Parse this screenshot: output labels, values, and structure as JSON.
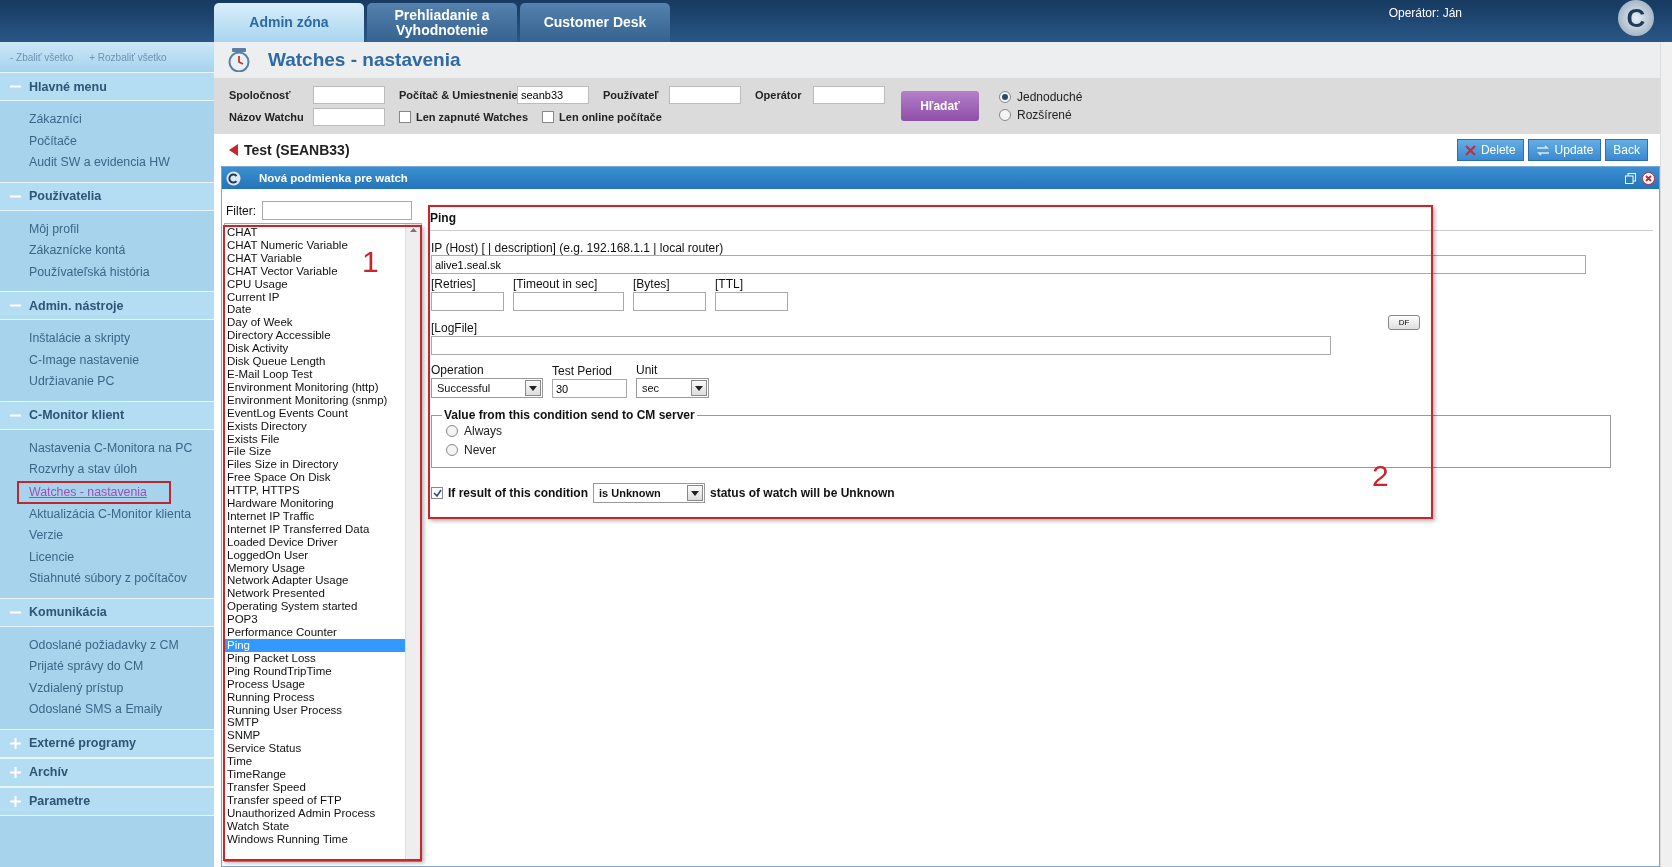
{
  "header": {
    "tabs": [
      {
        "label": "Admin zóna",
        "selected": true
      },
      {
        "label": "Prehliadanie a Vyhodnotenie",
        "selected": false
      },
      {
        "label": "Customer Desk",
        "selected": false
      }
    ],
    "operator": "Operátor: Ján",
    "logo": "C"
  },
  "sidebar": {
    "collapse_all": "- Zbaliť všetko",
    "expand_all": "+ Rozbaliť všetko",
    "sections": [
      {
        "title": "Hlavné menu",
        "expanded": true,
        "items": [
          {
            "label": "Zákazníci",
            "selected": false
          },
          {
            "label": "Počítače",
            "selected": false
          },
          {
            "label": "Audit SW a evidencia HW",
            "selected": false
          }
        ]
      },
      {
        "title": "Používatelia",
        "expanded": true,
        "items": [
          {
            "label": "Môj profil",
            "selected": false
          },
          {
            "label": "Zákaznícke kontá",
            "selected": false
          },
          {
            "label": "Používateľská história",
            "selected": false
          }
        ]
      },
      {
        "title": "Admin. nástroje",
        "expanded": true,
        "items": [
          {
            "label": "Inštalácie a skripty",
            "selected": false
          },
          {
            "label": "C-Image nastavenie",
            "selected": false
          },
          {
            "label": "Udržiavanie PC",
            "selected": false
          }
        ]
      },
      {
        "title": "C-Monitor klient",
        "expanded": true,
        "items": [
          {
            "label": "Nastavenia C-Monitora na PC",
            "selected": false
          },
          {
            "label": "Rozvrhy a stav úloh",
            "selected": false
          },
          {
            "label": "Watches - nastavenia",
            "selected": true
          },
          {
            "label": "Aktualizácia C-Monitor klienta",
            "selected": false
          },
          {
            "label": "Verzie",
            "selected": false
          },
          {
            "label": "Licencie",
            "selected": false
          },
          {
            "label": "Stiahnuté súbory z počítačov",
            "selected": false
          }
        ]
      },
      {
        "title": "Komunikácia",
        "expanded": true,
        "items": [
          {
            "label": "Odoslané požiadavky z CM",
            "selected": false
          },
          {
            "label": "Prijaté správy do CM",
            "selected": false
          },
          {
            "label": "Vzdialený prístup",
            "selected": false
          },
          {
            "label": "Odoslané SMS a Emaily",
            "selected": false
          }
        ]
      },
      {
        "title": "Externé programy",
        "expanded": false
      },
      {
        "title": "Archív",
        "expanded": false
      },
      {
        "title": "Parametre",
        "expanded": false
      }
    ]
  },
  "page_title": "Watches - nastavenia",
  "filter": {
    "fields": [
      {
        "label": "Spoločnosť"
      },
      {
        "label": "Počítač & Umiestnenie",
        "value": "seanb33"
      },
      {
        "label": "Používateľ"
      },
      {
        "label": "Operátor"
      },
      {
        "label": "Názov Watchu"
      }
    ],
    "checkboxes": [
      {
        "label": "Len zapnuté Watches",
        "checked": false
      },
      {
        "label": "Len online počítače",
        "checked": false
      }
    ],
    "search_button": "Hľadať",
    "modes": [
      {
        "label": "Jednoduché",
        "selected": true
      },
      {
        "label": "Rozšírené",
        "selected": false
      }
    ]
  },
  "record": {
    "title": "Test (SEANB33)",
    "buttons": [
      "Delete",
      "Update",
      "Back"
    ]
  },
  "dialog": {
    "title": "Nová podmienka pre watch",
    "filter_label": "Filter:",
    "types": [
      {
        "label": "CHAT",
        "selected": false
      },
      {
        "label": "CHAT Numeric Variable",
        "selected": false
      },
      {
        "label": "CHAT Variable",
        "selected": false
      },
      {
        "label": "CHAT Vector Variable",
        "selected": false
      },
      {
        "label": "CPU Usage",
        "selected": false
      },
      {
        "label": "Current IP",
        "selected": false
      },
      {
        "label": "Date",
        "selected": false
      },
      {
        "label": "Day of Week",
        "selected": false
      },
      {
        "label": "Directory Accessible",
        "selected": false
      },
      {
        "label": "Disk Activity",
        "selected": false
      },
      {
        "label": "Disk Queue Length",
        "selected": false
      },
      {
        "label": "E-Mail Loop Test",
        "selected": false
      },
      {
        "label": "Environment Monitoring (http)",
        "selected": false
      },
      {
        "label": "Environment Monitoring (snmp)",
        "selected": false
      },
      {
        "label": "EventLog Events Count",
        "selected": false
      },
      {
        "label": "Exists Directory",
        "selected": false
      },
      {
        "label": "Exists File",
        "selected": false
      },
      {
        "label": "File Size",
        "selected": false
      },
      {
        "label": "Files Size in Directory",
        "selected": false
      },
      {
        "label": "Free Space On Disk",
        "selected": false
      },
      {
        "label": "HTTP, HTTPS",
        "selected": false
      },
      {
        "label": "Hardware Monitoring",
        "selected": false
      },
      {
        "label": "Internet IP Traffic",
        "selected": false
      },
      {
        "label": "Internet IP Transferred Data",
        "selected": false
      },
      {
        "label": "Loaded Device Driver",
        "selected": false
      },
      {
        "label": "LoggedOn User",
        "selected": false
      },
      {
        "label": "Memory Usage",
        "selected": false
      },
      {
        "label": "Network Adapter Usage",
        "selected": false
      },
      {
        "label": "Network Presented",
        "selected": false
      },
      {
        "label": "Operating System started",
        "selected": false
      },
      {
        "label": "POP3",
        "selected": false
      },
      {
        "label": "Performance Counter",
        "selected": false
      },
      {
        "label": "Ping",
        "selected": true
      },
      {
        "label": "Ping Packet Loss",
        "selected": false
      },
      {
        "label": "Ping RoundTripTime",
        "selected": false
      },
      {
        "label": "Process Usage",
        "selected": false
      },
      {
        "label": "Running Process",
        "selected": false
      },
      {
        "label": "Running User Process",
        "selected": false
      },
      {
        "label": "SMTP",
        "selected": false
      },
      {
        "label": "SNMP",
        "selected": false
      },
      {
        "label": "Service Status",
        "selected": false
      },
      {
        "label": "Time",
        "selected": false
      },
      {
        "label": "TimeRange",
        "selected": false
      },
      {
        "label": "Transfer Speed",
        "selected": false
      },
      {
        "label": "Transfer speed of FTP",
        "selected": false
      },
      {
        "label": "Unauthorized Admin Process",
        "selected": false
      },
      {
        "label": "Watch State",
        "selected": false
      },
      {
        "label": "Windows Running Time",
        "selected": false
      }
    ],
    "form": {
      "title": "Ping",
      "host_label": "IP (Host) [ | description] (e.g. 192.168.1.1 | local router)",
      "host_value": "alive1.seal.sk",
      "small_fields": [
        {
          "label": "[Retries]"
        },
        {
          "label": "[Timeout in sec]"
        },
        {
          "label": "[Bytes]"
        },
        {
          "label": "[TTL]"
        }
      ],
      "logfile_label": "[LogFile]",
      "df_button": "DF",
      "operation_label": "Operation",
      "operation_value": "Successful",
      "period_label": "Test Period",
      "period_value": "30",
      "unit_label": "Unit",
      "unit_value": "sec",
      "send_legend": "Value from this condition send to CM server",
      "send_options": [
        {
          "label": "Always",
          "selected": false
        },
        {
          "label": "Never",
          "selected": false
        }
      ],
      "condition_checked": true,
      "condition_prefix": "If result of this condition",
      "condition_value": "is Unknown",
      "condition_suffix": "status of watch will be Unknown"
    }
  },
  "annotations": [
    "1",
    "2"
  ]
}
